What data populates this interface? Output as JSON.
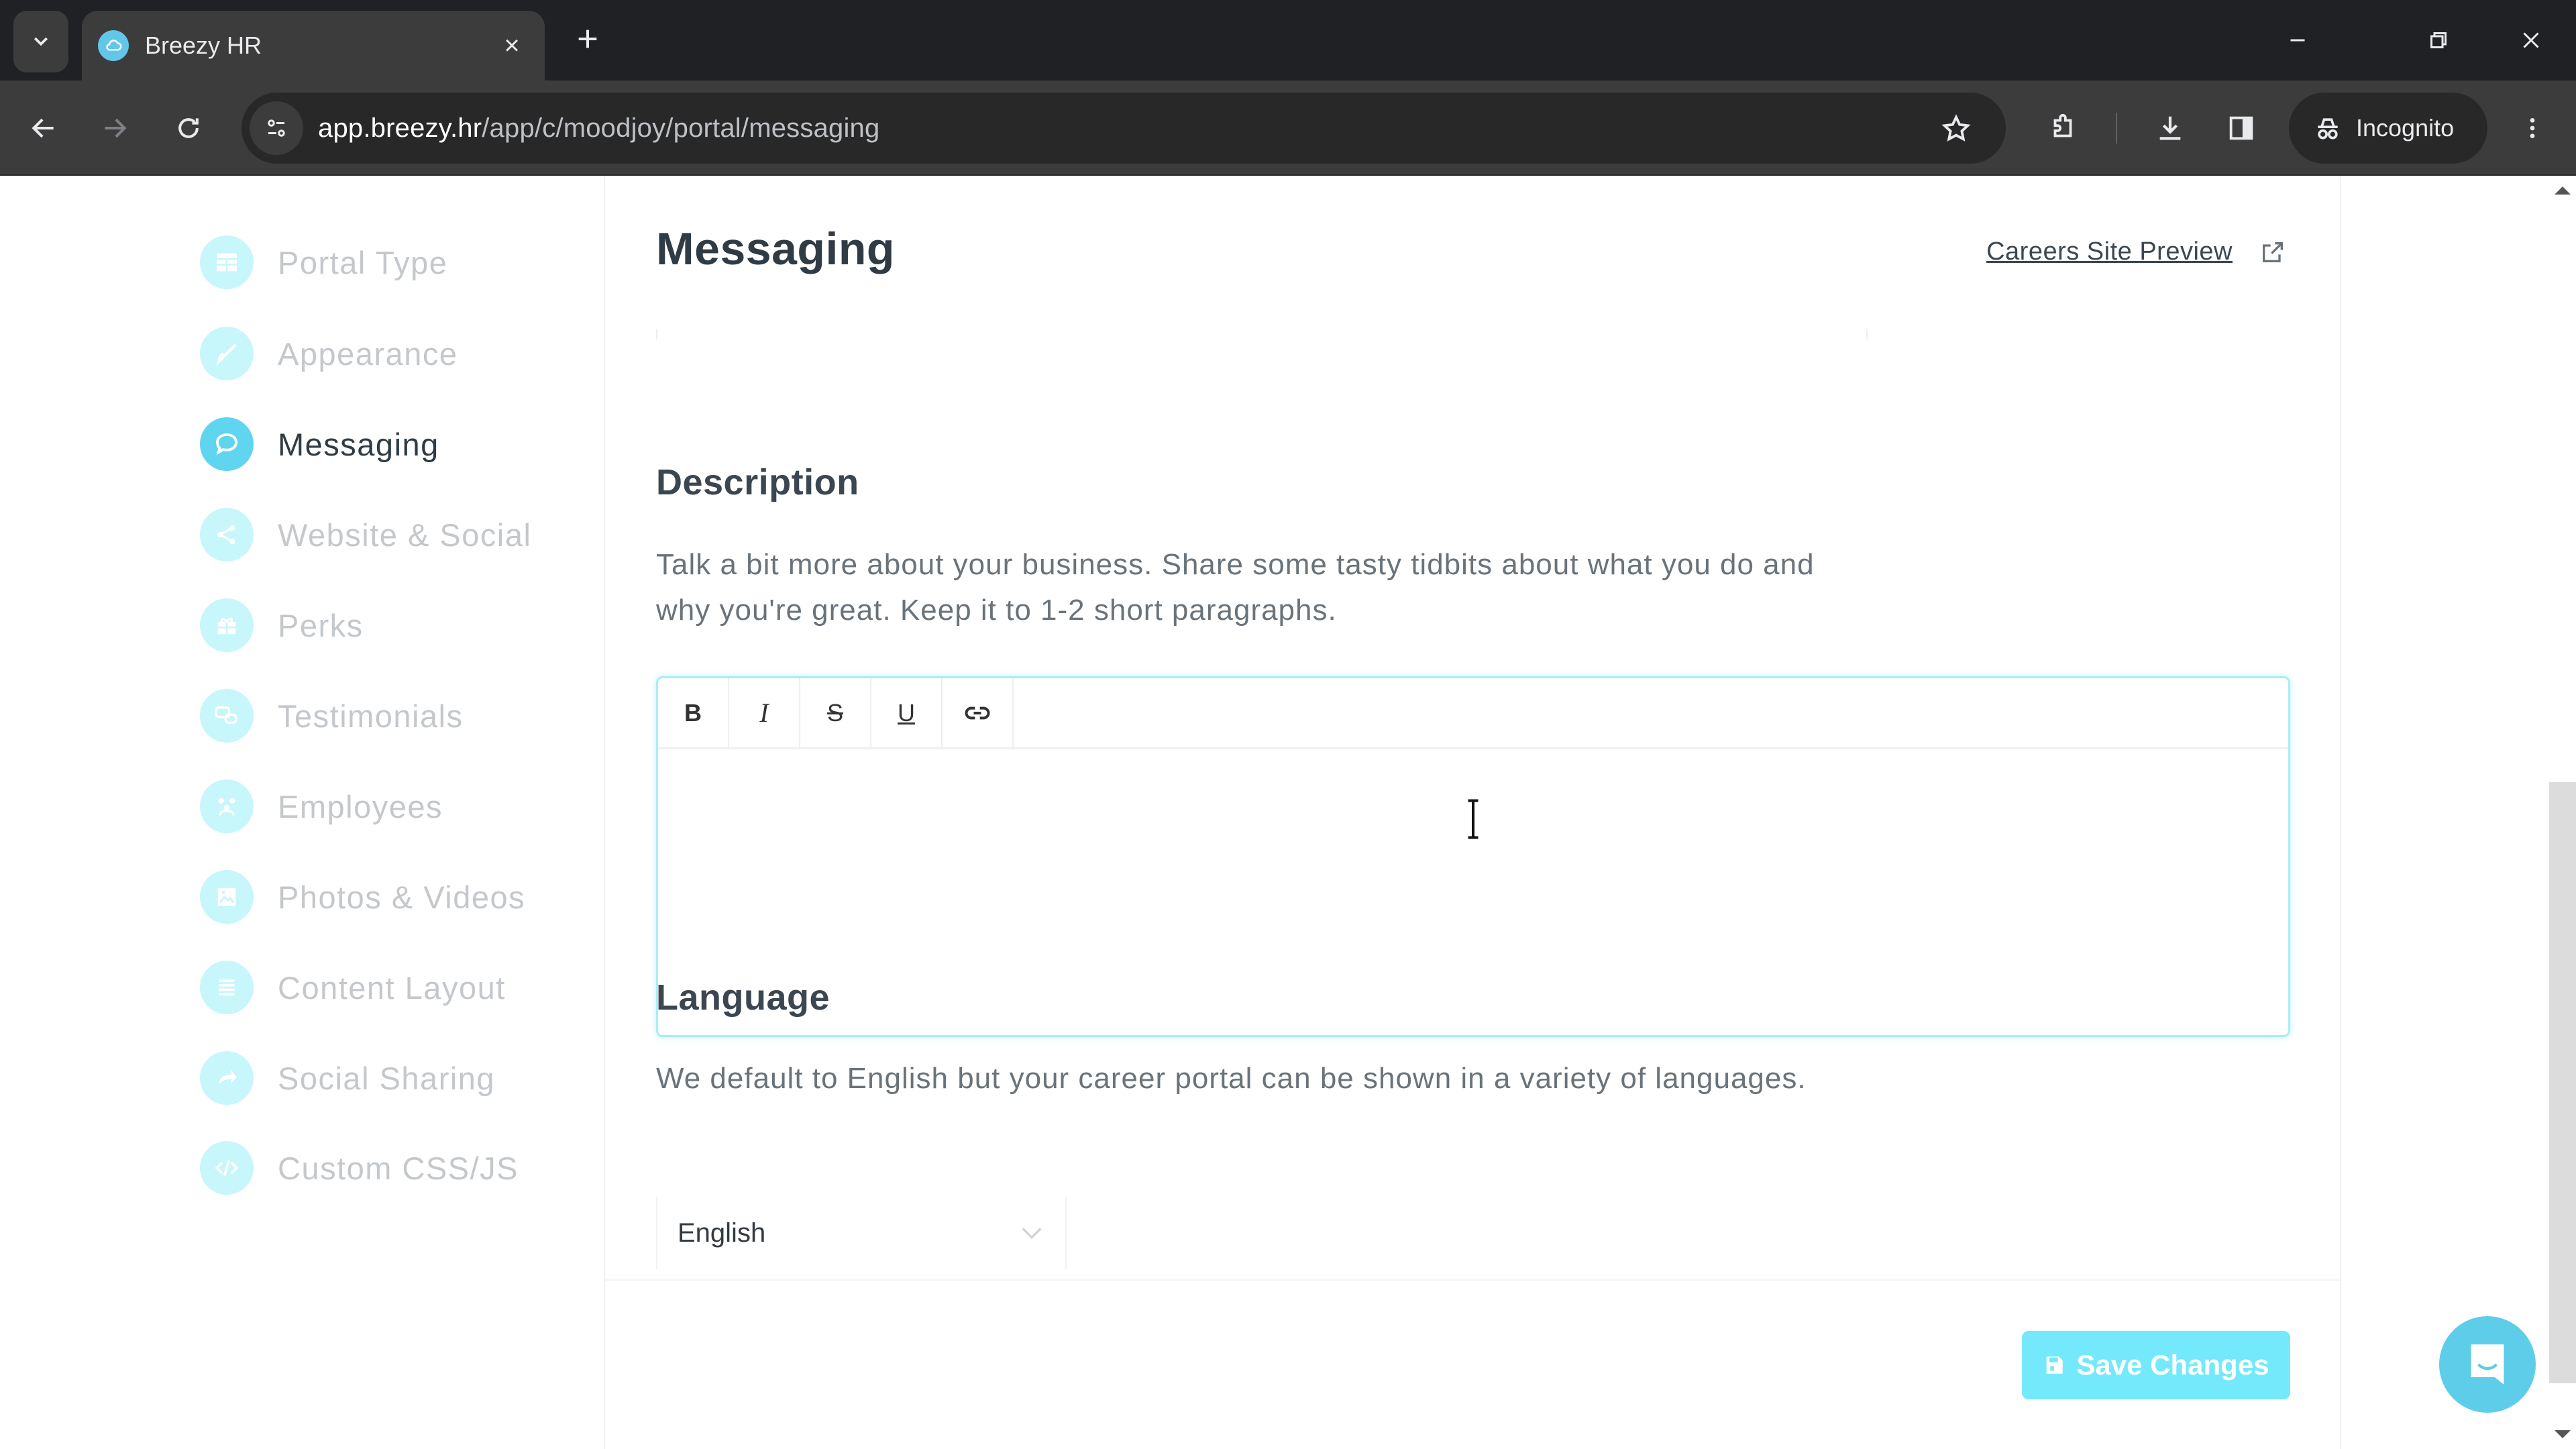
{
  "browser": {
    "tab": {
      "title": "Breezy HR",
      "close_glyph": "×",
      "favicon": "breezy-cloud-icon"
    },
    "new_tab_glyph": "+",
    "window_controls": {
      "minimize": "minimize-icon",
      "restore": "restore-icon",
      "close": "close-icon"
    },
    "url_host": "app.breezy.hr",
    "url_path": "/app/c/moodjoy/portal/messaging",
    "incognito_label": "Incognito"
  },
  "sidebar": {
    "items": [
      {
        "label": "Portal Type",
        "icon": "portal-type-icon",
        "active": false
      },
      {
        "label": "Appearance",
        "icon": "paintbrush-icon",
        "active": false
      },
      {
        "label": "Messaging",
        "icon": "chat-bubble-icon",
        "active": true
      },
      {
        "label": "Website & Social",
        "icon": "share-icon",
        "active": false
      },
      {
        "label": "Perks",
        "icon": "gift-icon",
        "active": false
      },
      {
        "label": "Testimonials",
        "icon": "comments-icon",
        "active": false
      },
      {
        "label": "Employees",
        "icon": "employees-icon",
        "active": false
      },
      {
        "label": "Photos & Videos",
        "icon": "image-icon",
        "active": false
      },
      {
        "label": "Content Layout",
        "icon": "list-icon",
        "active": false
      },
      {
        "label": "Social Sharing",
        "icon": "share-arrow-icon",
        "active": false
      },
      {
        "label": "Custom CSS/JS",
        "icon": "code-icon",
        "active": false
      }
    ]
  },
  "main": {
    "title": "Messaging",
    "preview_link": "Careers Site Preview",
    "description": {
      "heading": "Description",
      "help_text": "Talk a bit more about your business. Share some tasty tidbits about what you do and why you're great. Keep it to 1-2 short paragraphs.",
      "toolbar": {
        "bold": "B",
        "italic": "I",
        "strike": "S",
        "underline": "U",
        "link": "link-icon"
      },
      "value": ""
    },
    "language": {
      "heading": "Language",
      "help_text": "We default to English but your career portal can be shown in a variety of languages.",
      "selected": "English"
    },
    "save_label": "Save Changes"
  },
  "colors": {
    "accent": "#5fd5f0",
    "accent_light": "#c7f6fb",
    "save_button": "#74e9fc",
    "chat_launcher": "#5ecde9"
  }
}
